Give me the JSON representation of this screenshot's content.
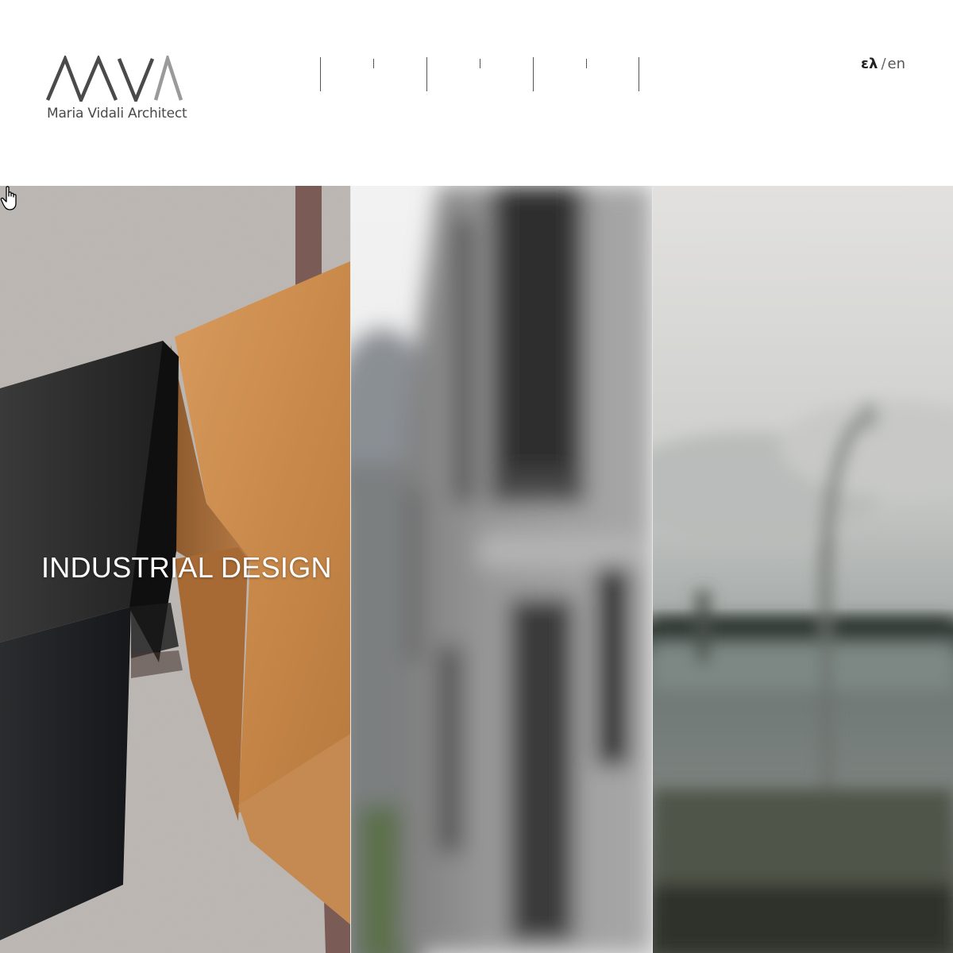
{
  "brand": {
    "logo_letters": "MVA",
    "name": "Maria Vidali Architect"
  },
  "nav": {
    "items": [
      "",
      "",
      ""
    ]
  },
  "language": {
    "greek": "ελ",
    "separator": "/",
    "english": "en"
  },
  "panels": [
    {
      "label": "INDUSTRIAL DESIGN",
      "image": "wooden-and-black-metal-object-photo"
    },
    {
      "label": "",
      "image": "blurred-building-facade-photo"
    },
    {
      "label": "",
      "image": "blurred-waterfront-lamp-photo"
    }
  ],
  "cursor": {
    "icon": "hand-pointer-icon"
  },
  "colors": {
    "logo_dark": "#4a4a4a",
    "logo_light": "#9a9a9a",
    "text": "#333333"
  }
}
